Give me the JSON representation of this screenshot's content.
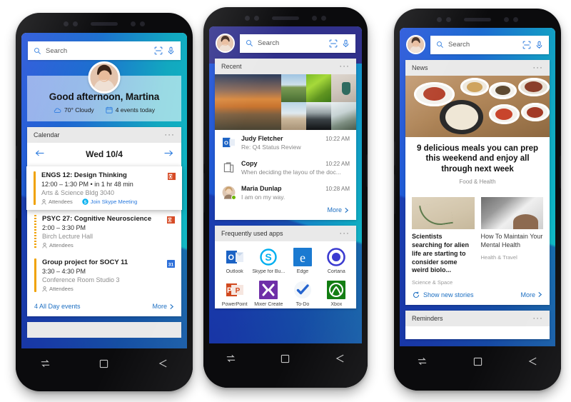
{
  "common": {
    "search_placeholder": "Search",
    "camera_icon": "camera-scan-icon",
    "mic_icon": "microphone-icon",
    "search_icon": "search-icon",
    "overflow": "···",
    "more_label": "More",
    "nav": {
      "recents": "recents-button",
      "home": "home-button",
      "back": "back-button"
    }
  },
  "phone1": {
    "greeting": {
      "title": "Good afternoon, Martina",
      "weather": "70° Cloudy",
      "events": "4 events today"
    },
    "calendar": {
      "header": "Calendar",
      "date": "Wed 10/4",
      "prev": "←",
      "next": "→",
      "events": [
        {
          "title": "ENGS 12: Design Thinking",
          "time": "12:00 – 1:30 PM • in 1 hr 48 min",
          "location": "Arts & Science Bldg 3040",
          "attendees": "Attendees",
          "skype": "Join Skype Meeting",
          "app": "outlook-icon",
          "accent": "#f0a202",
          "featured": true
        },
        {
          "title": "PSYC 27: Cognitive Neuroscience",
          "time": "2:00 – 3:30 PM",
          "location": "Birch Lecture Hall",
          "attendees": "Attendees",
          "skype": "",
          "app": "outlook-icon",
          "accent": "#f0a202",
          "featured": false
        },
        {
          "title": "Group project for SOCY 11",
          "time": "3:30 – 4:30 PM",
          "location": "Conference Room Studio 3",
          "attendees": "Attendees",
          "skype": "",
          "app": "calendar-31-icon",
          "accent": "#f0a202",
          "featured": false
        }
      ],
      "all_day": "4 All Day events",
      "more": "More"
    }
  },
  "phone2": {
    "recent": {
      "header": "Recent",
      "photos": [
        "photo-sunset-beach",
        "photo-green-field",
        "photo-aerial-forest",
        "photo-coffee-cup",
        "photo-boat-shore",
        "photo-storm-cloud",
        "photo-snow-trees"
      ],
      "items": [
        {
          "icon": "outlook-icon",
          "name": "Judy Fletcher",
          "time": "10:22 AM",
          "sub": "Re: Q4 Status Review",
          "presence": false
        },
        {
          "icon": "clipboard-icon",
          "name": "Copy",
          "time": "10:22 AM",
          "sub": "When deciding the layou of the doc...",
          "presence": false
        },
        {
          "icon": "avatar-icon",
          "name": "Maria Dunlap",
          "time": "10:28 AM",
          "sub": "I am on my way.",
          "presence": true
        }
      ],
      "more": "More"
    },
    "apps": {
      "header": "Frequently used apps",
      "items": [
        {
          "label": "Outlook",
          "icon": "outlook-icon"
        },
        {
          "label": "Skype for Bu...",
          "icon": "skype-icon"
        },
        {
          "label": "Edge",
          "icon": "edge-icon"
        },
        {
          "label": "Cortana",
          "icon": "cortana-icon"
        },
        {
          "label": "PowerPoint",
          "icon": "powerpoint-icon"
        },
        {
          "label": "Mixer Create",
          "icon": "mixer-icon"
        },
        {
          "label": "To-Do",
          "icon": "todo-icon"
        },
        {
          "label": "Xbox",
          "icon": "xbox-icon"
        }
      ]
    }
  },
  "phone3": {
    "news": {
      "header": "News",
      "hero": {
        "title": "9 delicious meals you can prep this weekend and enjoy all through next week",
        "category": "Food & Health",
        "image": "photo-korean-meal-spread"
      },
      "stories": [
        {
          "title": "Scientists searching for alien life are starting to consider some weird biolo...",
          "category": "Science & Space",
          "image": "photo-satellite-river"
        },
        {
          "title": "How To Maintain Your Mental Health",
          "category": "Health & Travel",
          "image": "photo-person-room"
        }
      ],
      "refresh": "Show new stories",
      "more": "More"
    },
    "reminders": {
      "header": "Reminders"
    }
  }
}
